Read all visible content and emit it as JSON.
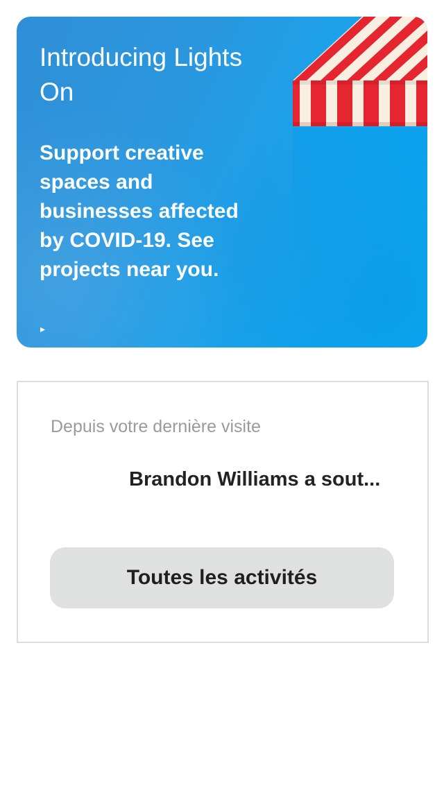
{
  "promo": {
    "title": "Introducing Lights On",
    "body": "Support creative spaces and businesses affected by COVID-19. See projects near you.",
    "play_glyph": "▸",
    "colors": {
      "background": "#2a97df",
      "awning_red": "#e5252f",
      "awning_white": "#f8efe0"
    },
    "image": "striped-awning-illustration"
  },
  "activity": {
    "heading": "Depuis votre dernière visite",
    "items": [
      {
        "text": "Brandon Williams a sout..."
      }
    ],
    "all_button_label": "Toutes les activités"
  }
}
